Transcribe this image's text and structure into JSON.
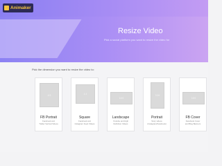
{
  "app": {
    "logo_text": "Animaker"
  },
  "hero": {
    "title": "Resize Video",
    "subtitle": "Pick a social platform you want to resize the video for"
  },
  "main": {
    "instruction": "Pick the dimension you want to resize the video to:",
    "cards": [
      {
        "ratio": "4:5",
        "title": "FB Portrait",
        "desc1": "Facebook and",
        "desc2": "Twitter Vertical Videos"
      },
      {
        "ratio": "1:1",
        "title": "Square",
        "desc1": "Facebook and",
        "desc2": "Instagram Feed Videos"
      },
      {
        "ratio": "16:9",
        "title": "Landscape",
        "desc1": "Youtube and High",
        "desc2": "Definition Videos"
      },
      {
        "ratio": "9:16",
        "title": "Portrait",
        "desc1": "Story videos",
        "desc2": "(Instagram/Facebook)"
      },
      {
        "ratio": "16:9",
        "title": "FB Cover",
        "desc1": "Facebook Cover",
        "desc2": "and Blog Banners"
      }
    ]
  }
}
